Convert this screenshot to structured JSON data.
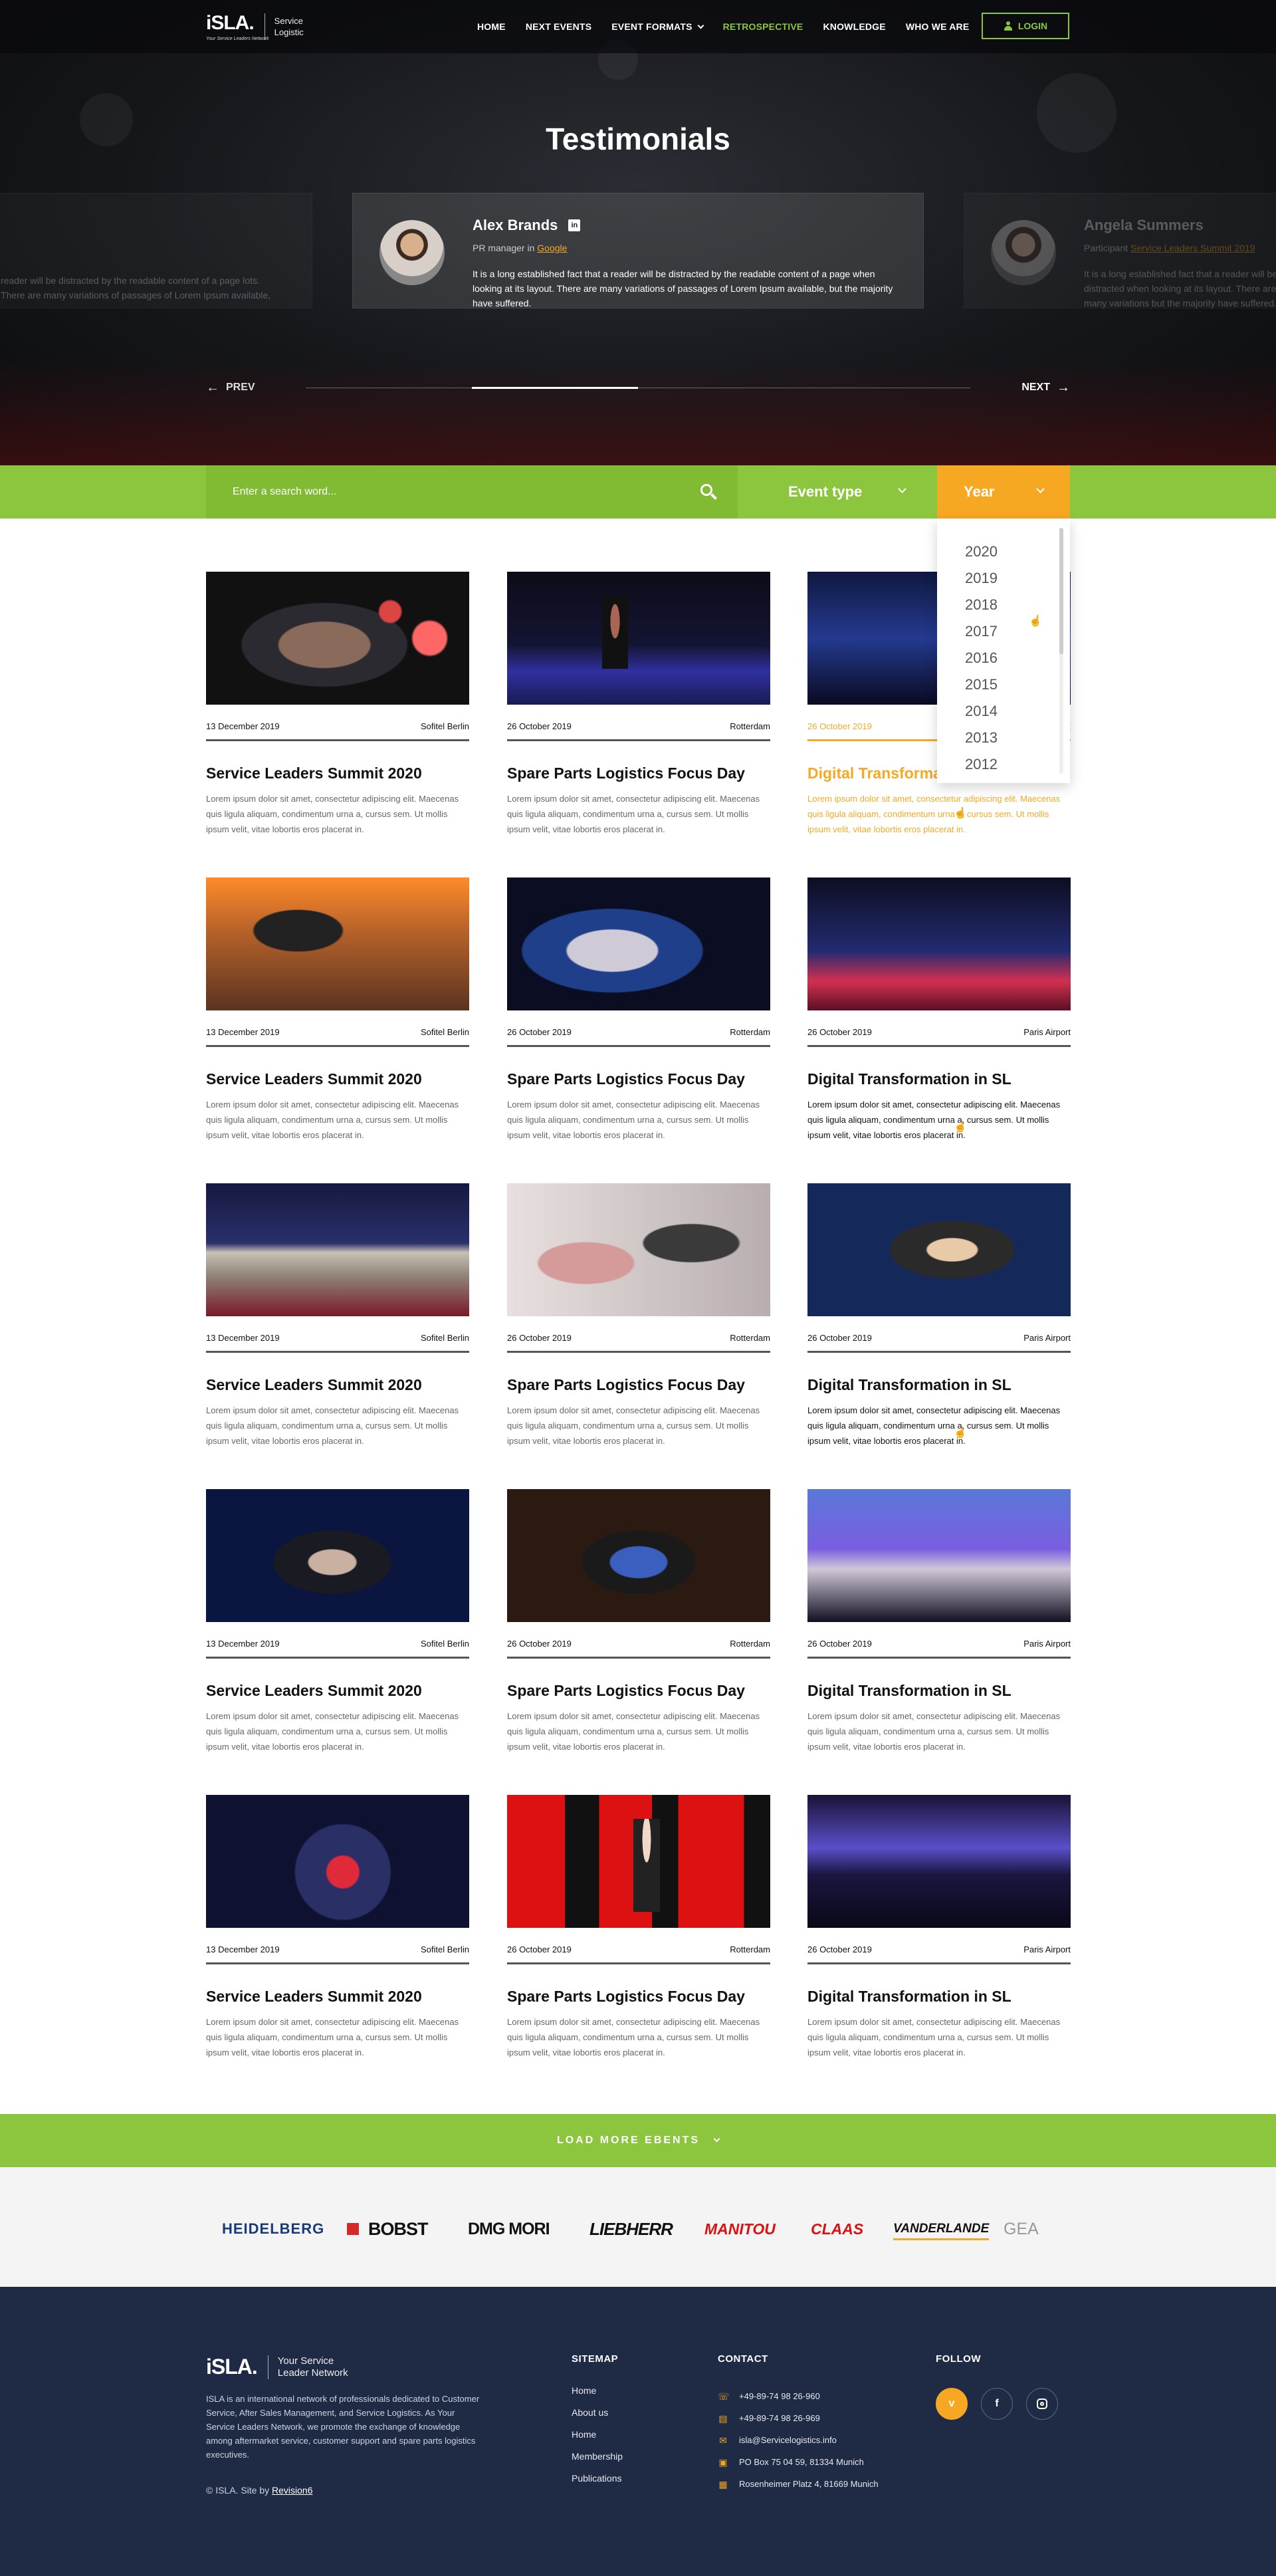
{
  "header": {
    "logo_text": "iSLA.",
    "logo_tagline": "Your Service Leaders Network",
    "logo_sub_line1": "Service",
    "logo_sub_line2": "Logistic",
    "nav": [
      {
        "label": "HOME",
        "active": false
      },
      {
        "label": "NEXT EVENTS",
        "active": false
      },
      {
        "label": "EVENT FORMATS",
        "active": false,
        "dropdown": true
      },
      {
        "label": "RETROSPECTIVE",
        "active": true
      },
      {
        "label": "KNOWLEDGE",
        "active": false
      },
      {
        "label": "WHO WE ARE",
        "active": false
      }
    ],
    "login_label": "LOGIN"
  },
  "hero": {
    "title": "Testimonials",
    "testimonials": [
      {
        "name": "",
        "role_prefix": "",
        "company": "",
        "quote": "reader will be distracted by the readable content of a page lots. There are many variations of passages of Lorem Ipsum available,"
      },
      {
        "name": "Alex Brands",
        "role_prefix": "PR manager in",
        "company": "Google",
        "quote": "It is a long established fact that a reader will be distracted by the readable content of a page when looking at its layout. There are many variations of passages of Lorem Ipsum available, but the majority have suffered."
      },
      {
        "name": "Angela Summers",
        "role_prefix": "Participant",
        "company": "Service Leaders Summit 2019",
        "quote": "It is a long established fact that a reader will be distracted when looking at its layout. There are many variations but the majority have suffered."
      }
    ],
    "prev_label": "PREV",
    "next_label": "NEXT",
    "slider_progress": 0.25
  },
  "filters": {
    "search_placeholder": "Enter a search word...",
    "event_type_label": "Event type",
    "year_label": "Year",
    "year_options": [
      "2020",
      "2019",
      "2018",
      "2017",
      "2016",
      "2015",
      "2014",
      "2013",
      "2012"
    ]
  },
  "events": [
    {
      "date": "13 December 2019",
      "location": "Sofitel Berlin",
      "title": "Service Leaders Summit 2020",
      "desc": "Lorem ipsum dolor sit amet, consectetur adipiscing elit. Maecenas quis ligula aliquam, condimentum urna a, cursus sem. Ut mollis ipsum velit, vitae lobortis eros placerat in."
    },
    {
      "date": "26 October 2019",
      "location": "Rotterdam",
      "title": "Spare Parts Logistics Focus Day",
      "desc": "Lorem ipsum dolor sit amet, consectetur adipiscing elit. Maecenas quis ligula aliquam, condimentum urna a, cursus sem. Ut mollis ipsum velit, vitae lobortis eros placerat in."
    },
    {
      "date": "26 October 2019",
      "location": "Paris Airport",
      "title": "Digital Transformation in SL",
      "desc": "Lorem ipsum dolor sit amet, consectetur adipiscing elit. Maecenas quis ligula aliquam, condimentum urna a, cursus sem. Ut mollis ipsum velit, vitae lobortis eros placerat in."
    },
    {
      "date": "13 December 2019",
      "location": "Sofitel Berlin",
      "title": "Service Leaders Summit 2020",
      "desc": "Lorem ipsum dolor sit amet, consectetur adipiscing elit. Maecenas quis ligula aliquam, condimentum urna a, cursus sem. Ut mollis ipsum velit, vitae lobortis eros placerat in."
    },
    {
      "date": "26 October 2019",
      "location": "Rotterdam",
      "title": "Spare Parts Logistics Focus Day",
      "desc": "Lorem ipsum dolor sit amet, consectetur adipiscing elit. Maecenas quis ligula aliquam, condimentum urna a, cursus sem. Ut mollis ipsum velit, vitae lobortis eros placerat in."
    },
    {
      "date": "26 October 2019",
      "location": "Paris Airport",
      "title": "Digital Transformation in SL",
      "desc": "Lorem ipsum dolor sit amet, consectetur adipiscing elit. Maecenas quis ligula aliquam, condimentum urna a, cursus sem. Ut mollis ipsum velit, vitae lobortis eros placerat in."
    },
    {
      "date": "13 December 2019",
      "location": "Sofitel Berlin",
      "title": "Service Leaders Summit 2020",
      "desc": "Lorem ipsum dolor sit amet, consectetur adipiscing elit. Maecenas quis ligula aliquam, condimentum urna a, cursus sem. Ut mollis ipsum velit, vitae lobortis eros placerat in."
    },
    {
      "date": "26 October 2019",
      "location": "Rotterdam",
      "title": "Spare Parts Logistics Focus Day",
      "desc": "Lorem ipsum dolor sit amet, consectetur adipiscing elit. Maecenas quis ligula aliquam, condimentum urna a, cursus sem. Ut mollis ipsum velit, vitae lobortis eros placerat in."
    },
    {
      "date": "26 October 2019",
      "location": "Paris Airport",
      "title": "Digital Transformation in SL",
      "desc": "Lorem ipsum dolor sit amet, consectetur adipiscing elit. Maecenas quis ligula aliquam, condimentum urna a, cursus sem. Ut mollis ipsum velit, vitae lobortis eros placerat in."
    },
    {
      "date": "13 December 2019",
      "location": "Sofitel Berlin",
      "title": "Service Leaders Summit 2020",
      "desc": "Lorem ipsum dolor sit amet, consectetur adipiscing elit. Maecenas quis ligula aliquam, condimentum urna a, cursus sem. Ut mollis ipsum velit, vitae lobortis eros placerat in."
    },
    {
      "date": "26 October 2019",
      "location": "Rotterdam",
      "title": "Spare Parts Logistics Focus Day",
      "desc": "Lorem ipsum dolor sit amet, consectetur adipiscing elit. Maecenas quis ligula aliquam, condimentum urna a, cursus sem. Ut mollis ipsum velit, vitae lobortis eros placerat in."
    },
    {
      "date": "26 October 2019",
      "location": "Paris Airport",
      "title": "Digital Transformation in SL",
      "desc": "Lorem ipsum dolor sit amet, consectetur adipiscing elit. Maecenas quis ligula aliquam, condimentum urna a, cursus sem. Ut mollis ipsum velit, vitae lobortis eros placerat in."
    },
    {
      "date": "13 December 2019",
      "location": "Sofitel Berlin",
      "title": "Service Leaders Summit 2020",
      "desc": "Lorem ipsum dolor sit amet, consectetur adipiscing elit. Maecenas quis ligula aliquam, condimentum urna a, cursus sem. Ut mollis ipsum velit, vitae lobortis eros placerat in."
    },
    {
      "date": "26 October 2019",
      "location": "Rotterdam",
      "title": "Spare Parts Logistics Focus Day",
      "desc": "Lorem ipsum dolor sit amet, consectetur adipiscing elit. Maecenas quis ligula aliquam, condimentum urna a, cursus sem. Ut mollis ipsum velit, vitae lobortis eros placerat in."
    },
    {
      "date": "26 October 2019",
      "location": "Paris Airport",
      "title": "Digital Transformation in SL",
      "desc": "Lorem ipsum dolor sit amet, consectetur adipiscing elit. Maecenas quis ligula aliquam, condimentum urna a, cursus sem. Ut mollis ipsum velit, vitae lobortis eros placerat in."
    }
  ],
  "load_more_label": "LOAD MORE EBENTS",
  "partners": [
    "HEIDELBERG",
    "BOBST",
    "DMG MORI",
    "LIEBHERR",
    "MANITOU",
    "CLAAS",
    "VANDERLANDE",
    "GEA"
  ],
  "footer": {
    "logo_text": "iSLA.",
    "logo_sub_line1": "Your Service",
    "logo_sub_line2": "Leader Network",
    "about": "ISLA is an international network of professionals dedicated to Customer Service, After Sales Management, and Service Logistics. As Your Service Leaders Network, we promote the exchange of knowledge among aftermarket service, customer support and spare parts logistics executives.",
    "copyright": "© ISLA. Site by",
    "credit": "Revision6",
    "sitemap_title": "SITEMAP",
    "sitemap": [
      "Home",
      "About us",
      "Home",
      "Membership",
      "Publications"
    ],
    "contact_title": "CONTACT",
    "contact": [
      {
        "icon": "phone-icon",
        "text": "+49-89-74 98 26-960"
      },
      {
        "icon": "fax-icon",
        "text": "+49-89-74 98 26-969"
      },
      {
        "icon": "mail-icon",
        "text": "isla@Servicelogistics.info"
      },
      {
        "icon": "mailbox-icon",
        "text": "PO Box 75 04 59, 81334 Munich"
      },
      {
        "icon": "building-icon",
        "text": "Rosenheimer Platz 4, 81669 Munich"
      }
    ],
    "follow_title": "FOLLOW",
    "social": [
      {
        "icon": "vimeo-icon",
        "glyph": "v"
      },
      {
        "icon": "facebook-icon",
        "glyph": "f"
      },
      {
        "icon": "instagram-icon",
        "glyph": ""
      }
    ]
  },
  "colors": {
    "green": "#8cc63f",
    "orange": "#f7a823",
    "navy": "#1f2a44"
  }
}
